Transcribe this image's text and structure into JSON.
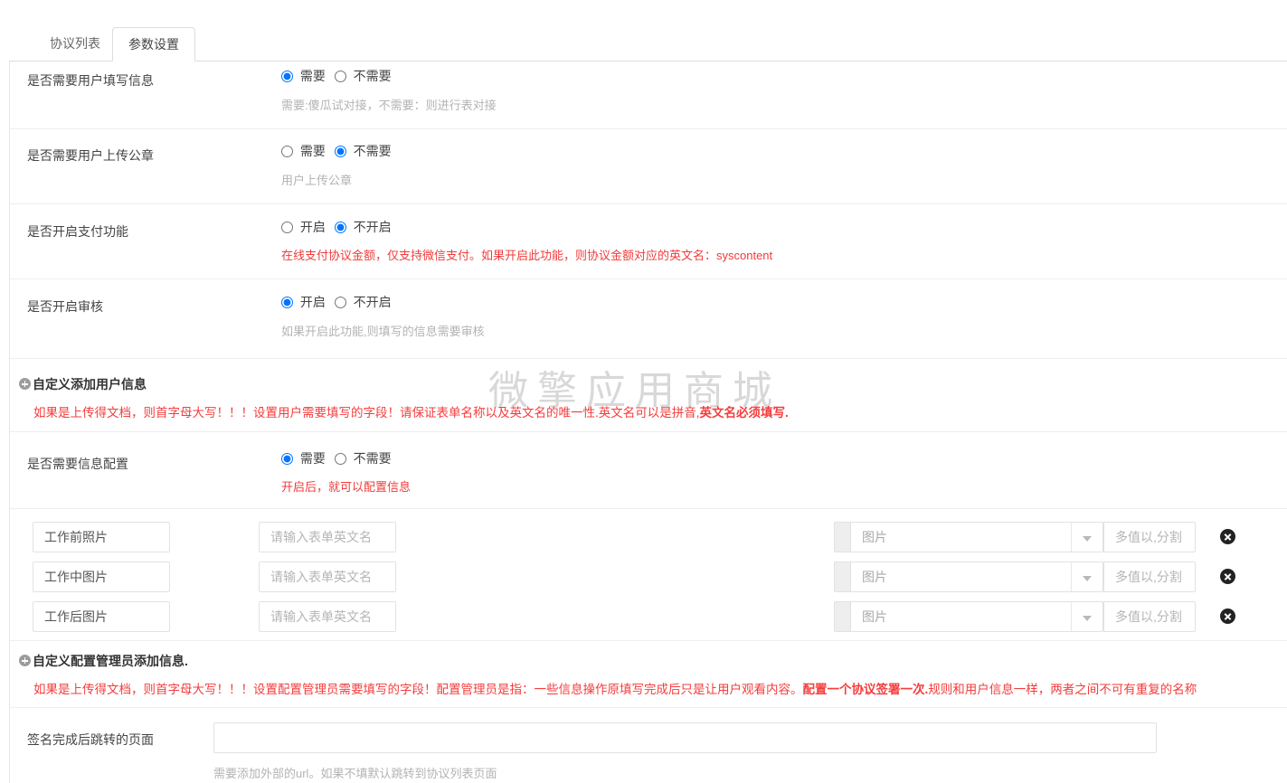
{
  "watermark": "微擎应用商城",
  "tabs": [
    {
      "label": "协议列表",
      "active": false
    },
    {
      "label": "参数设置",
      "active": true
    }
  ],
  "settings": [
    {
      "label": "是否需要用户填写信息",
      "options": [
        "需要",
        "不需要"
      ],
      "selected": 0,
      "help": "需要:傻瓜试对接，不需要：则进行表对接",
      "help_color": "#b3b3b3"
    },
    {
      "label": "是否需要用户上传公章",
      "options": [
        "需要",
        "不需要"
      ],
      "selected": 1,
      "help": "用户上传公章",
      "help_color": "#b3b3b3"
    },
    {
      "label": "是否开启支付功能",
      "options": [
        "开启",
        "不开启"
      ],
      "selected": 1,
      "help": "在线支付协议金额，仅支持微信支付。如果开启此功能，则协议金额对应的英文名：syscontent",
      "help_color": "#f53c3c"
    },
    {
      "label": "是否开启审核",
      "options": [
        "开启",
        "不开启"
      ],
      "selected": 0,
      "help": "如果开启此功能,则填写的信息需要审核",
      "help_color": "#b3b3b3"
    }
  ],
  "user_info_section": {
    "title": "自定义添加用户信息",
    "plus_icon": "plus-circle-icon",
    "note_plain_1": "如果是上传得文档，则首字母大写！！！设置用户需要填写的字段！请保证表单名称以及英文名的唯一性.英文名可以是拼音,",
    "note_bold_1": "英文名必须填写.",
    "toggle": {
      "label": "是否需要信息配置",
      "options": [
        "需要",
        "不需要"
      ],
      "selected": 0,
      "help": "开启后，就可以配置信息",
      "help_color": "#f53c3c"
    },
    "rows": [
      {
        "name_value": "工作前照片",
        "en_placeholder": "请输入表单英文名",
        "type_value": "图片",
        "multi_placeholder": "多值以,分割",
        "delete_icon": "delete-circle-icon"
      },
      {
        "name_value": "工作中图片",
        "en_placeholder": "请输入表单英文名",
        "type_value": "图片",
        "multi_placeholder": "多值以,分割",
        "delete_icon": "delete-circle-icon"
      },
      {
        "name_value": "工作后图片",
        "en_placeholder": "请输入表单英文名",
        "type_value": "图片",
        "multi_placeholder": "多值以,分割",
        "delete_icon": "delete-circle-icon"
      }
    ]
  },
  "admin_info_section": {
    "title": "自定义配置管理员添加信息.",
    "plus_icon": "plus-circle-icon",
    "note_plain_1": "如果是上传得文档，则首字母大写！！！设置配置管理员需要填写的字段！配置管理员是指：一些信息操作原填写完成后只是让用户观看内容。",
    "note_bold_1": "配置一个协议签署一次.",
    "note_plain_2": "规则和用户信息一样，两者之间不可有重复的名称",
    "redirect": {
      "label": "签名完成后跳转的页面",
      "value": "",
      "placeholder": "",
      "help": "需要添加外部的url。如果不填默认跳转到协议列表页面",
      "help_color": "#b3b3b3"
    }
  }
}
